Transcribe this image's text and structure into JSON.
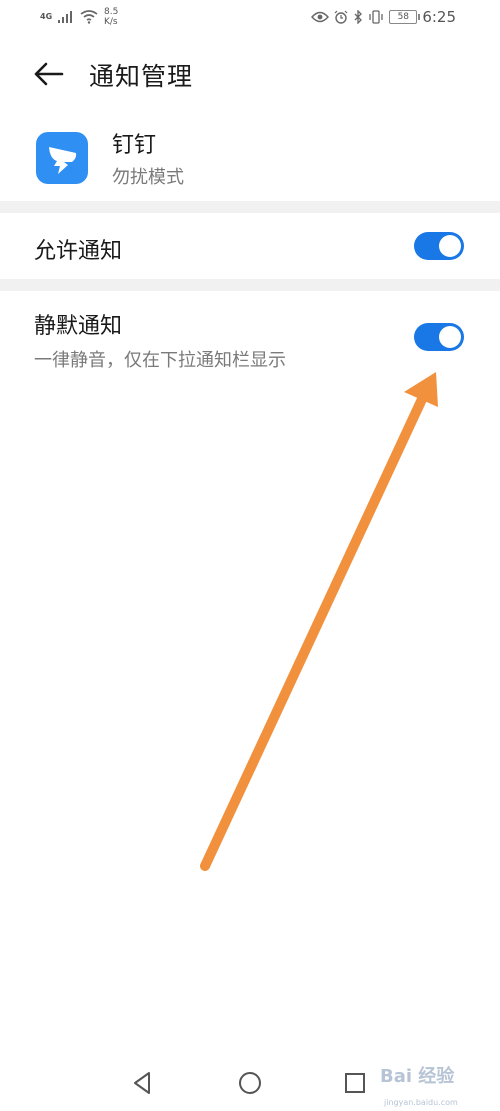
{
  "status_bar": {
    "network": "4G",
    "speed": "8.5\nK/s",
    "battery": "58",
    "time": "6:25"
  },
  "header": {
    "title": "通知管理"
  },
  "app": {
    "name": "钉钉",
    "mode": "勿扰模式"
  },
  "settings": [
    {
      "title": "允许通知",
      "enabled": true
    },
    {
      "title": "静默通知",
      "subtitle": "一律静音，仅在下拉通知栏显示",
      "enabled": true
    }
  ],
  "watermark": {
    "text": "Bai 经验",
    "sub": "jingyan.baidu.com"
  },
  "colors": {
    "accent": "#1a78e6",
    "arrow": "#f2913d",
    "app_icon": "#2f8ff2"
  }
}
